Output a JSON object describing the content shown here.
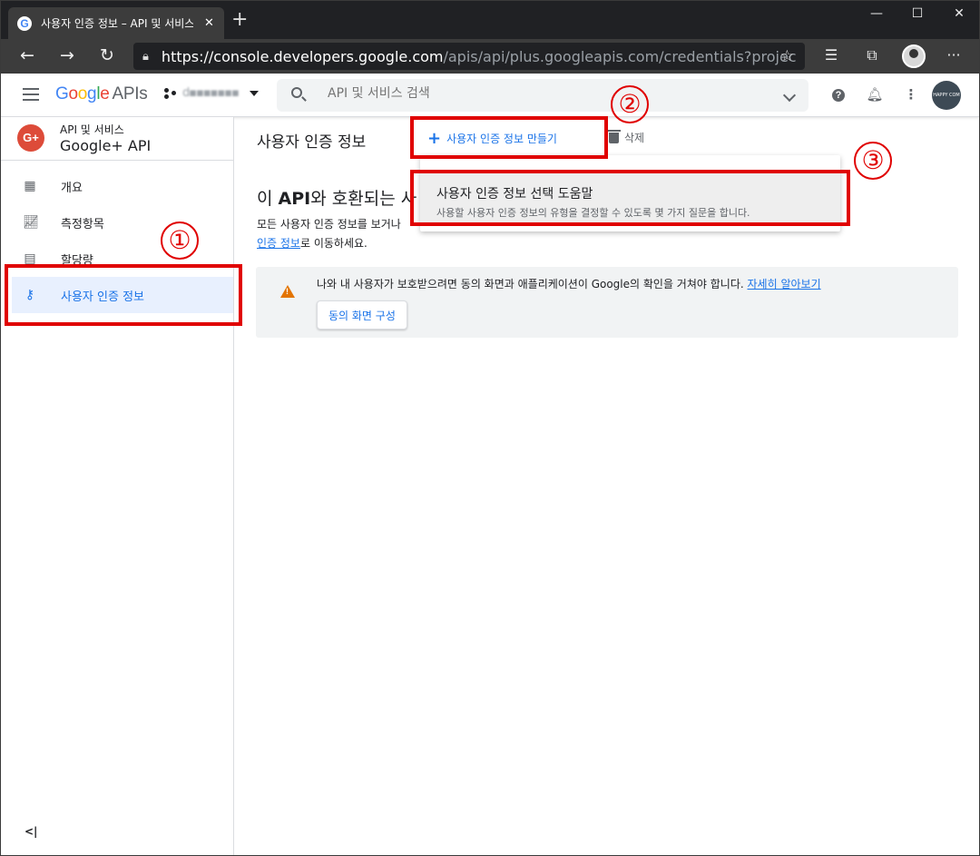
{
  "browser": {
    "tab_title": "사용자 인증 정보 – API 및 서비스",
    "tab_favicon": "G",
    "tab_close": "✕",
    "new_tab": "+",
    "url_host": "https://console.developers.google.com",
    "url_path": "/apis/api/plus.googleapis.com/credentials?project=L"
  },
  "header": {
    "logo_google": "Google",
    "logo_apis": "APIs",
    "project_name": "d▪▪▪▪▪▪▪▪",
    "search_placeholder": "API 및 서비스 검색",
    "avatar_text": "HAPPY COM"
  },
  "sidebar": {
    "api_super": "API 및 서비스",
    "api_name": "Google+ API",
    "api_icon": "G+",
    "items": [
      {
        "label": "개요",
        "icon": "dashboard-icon"
      },
      {
        "label": "측정항목",
        "icon": "metrics-icon"
      },
      {
        "label": "할당량",
        "icon": "quota-icon"
      },
      {
        "label": "사용자 인증 정보",
        "icon": "key-icon"
      }
    ],
    "collapse_label": "<|"
  },
  "main": {
    "page_title": "사용자 인증 정보",
    "create_label": "사용자 인증 정보 만들기",
    "delete_label": "삭제",
    "heading_prefix": "이 ",
    "heading_bold": "API",
    "heading_suffix": "와 호환되는 사",
    "para_line1": "모든 사용자 인증 정보를 보거나",
    "para_link": "인증 정보",
    "para_line2_suffix": "로 이동하세요.",
    "warning_text": "나와 내 사용자가 보호받으려면 동의 화면과 애플리케이션이 Google의 확인을 거쳐야 합니다.",
    "warning_link": "자세히 알아보기",
    "consent_button": "동의 화면 구성"
  },
  "menu": {
    "title": "사용자 인증 정보 선택 도움말",
    "description": "사용할 사용자 인증 정보의 유형을 결정할 수 있도록 몇 가지 질문을 합니다."
  },
  "annotations": {
    "step1": "①",
    "step2": "②",
    "step3": "③",
    "color": "#e00000"
  }
}
